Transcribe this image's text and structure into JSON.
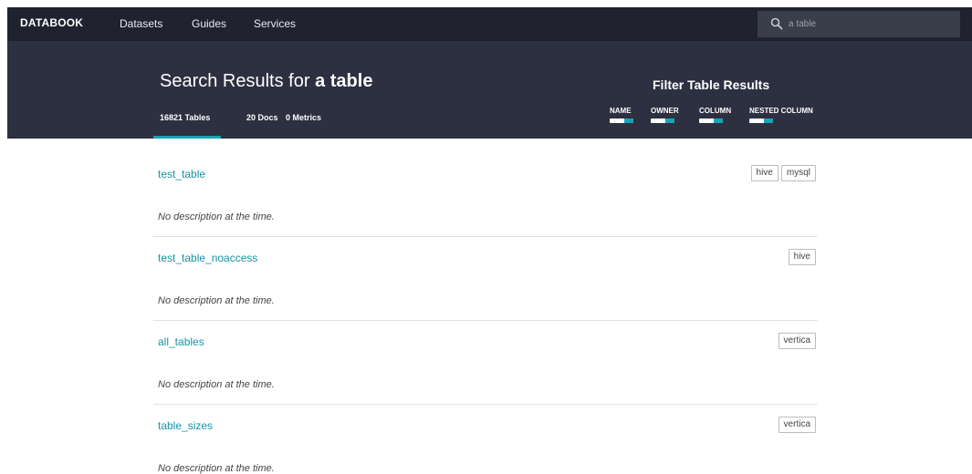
{
  "topbar": {
    "brand": "DATABOOK",
    "nav": [
      "Datasets",
      "Guides",
      "Services"
    ],
    "search_value": "a table"
  },
  "hero": {
    "title_prefix": "Search Results for",
    "query": "a table",
    "tabs": [
      {
        "label": "16821 Tables",
        "active": true
      },
      {
        "label": "20 Docs",
        "active": false
      },
      {
        "label": "0 Metrics",
        "active": false
      }
    ],
    "filter_title": "Filter Table Results",
    "filters": [
      "NAME",
      "OWNER",
      "COLUMN",
      "NESTED COLUMN"
    ]
  },
  "results": [
    {
      "name": "test_table",
      "description": "No description at the time.",
      "badges": [
        "hive",
        "mysql"
      ]
    },
    {
      "name": "test_table_noaccess",
      "description": "No description at the time.",
      "badges": [
        "hive"
      ]
    },
    {
      "name": "all_tables",
      "description": "No description at the time.",
      "badges": [
        "vertica"
      ]
    },
    {
      "name": "table_sizes",
      "description": "No description at the time.",
      "badges": [
        "vertica"
      ]
    }
  ],
  "colors": {
    "topbar_bg": "#20232f",
    "hero_bg": "#2c3040",
    "accent": "#1aa3b5",
    "link": "#1793a5"
  },
  "icons": {
    "search": "search-icon"
  }
}
